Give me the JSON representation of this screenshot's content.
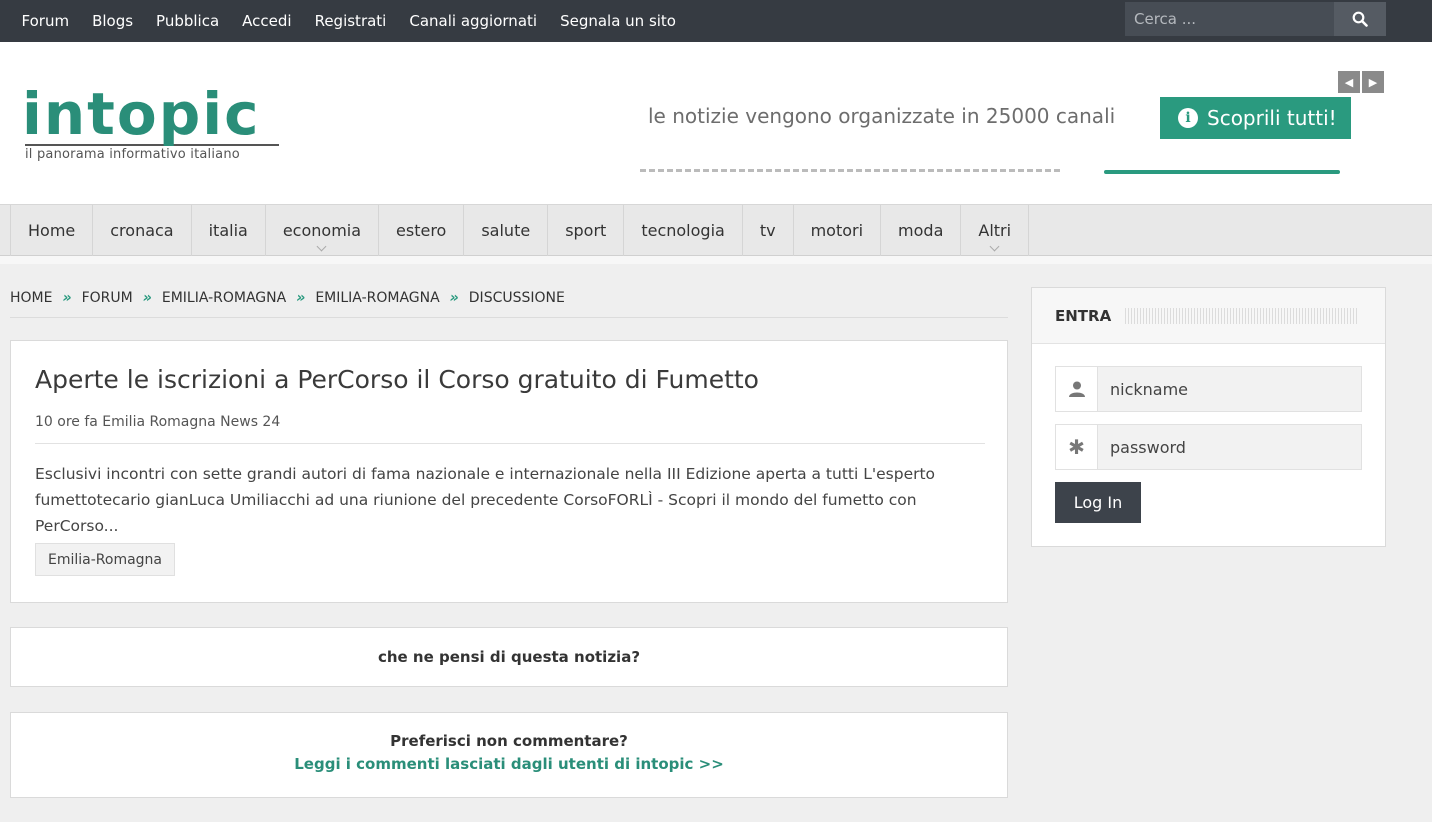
{
  "topbar": {
    "links": [
      "Forum",
      "Blogs",
      "Pubblica",
      "Accedi",
      "Registrati",
      "Canali aggiornati",
      "Segnala un sito"
    ],
    "search_placeholder": "Cerca ..."
  },
  "header": {
    "logo": "intopic",
    "tagline": "il panorama informativo italiano",
    "promo_text": "le notizie vengono organizzate in 25000 canali",
    "promo_button": "Scoprili tutti!"
  },
  "mainnav": {
    "items": [
      "Home",
      "cronaca",
      "italia",
      "economia",
      "estero",
      "salute",
      "sport",
      "tecnologia",
      "tv",
      "motori",
      "moda",
      "Altri"
    ]
  },
  "breadcrumb": [
    "HOME",
    "FORUM",
    "EMILIA-ROMAGNA",
    "EMILIA-ROMAGNA",
    "DISCUSSIONE"
  ],
  "article": {
    "title": "Aperte le iscrizioni a PerCorso il Corso gratuito di Fumetto",
    "meta": "10 ore fa Emilia Romagna News 24",
    "body": "Esclusivi incontri con sette grandi autori di fama nazionale e internazionale nella III Edizione aperta a tutti L'esperto fumettotecario gianLuca Umiliacchi ad una riunione del precedente CorsoFORLÌ - Scopri il mondo del fumetto con PerCorso...",
    "tag": "Emilia-Romagna"
  },
  "opinion": {
    "text": "che ne pensi di questa notizia?"
  },
  "nocomment": {
    "question": "Preferisci non commentare?",
    "link": "Leggi i commenti lasciati dagli utenti di intopic >>"
  },
  "login": {
    "title": "ENTRA",
    "nickname_placeholder": "nickname",
    "password_placeholder": "password",
    "button": "Log In"
  },
  "colors": {
    "brand": "#2a9a7f",
    "topbar": "#363b42"
  }
}
